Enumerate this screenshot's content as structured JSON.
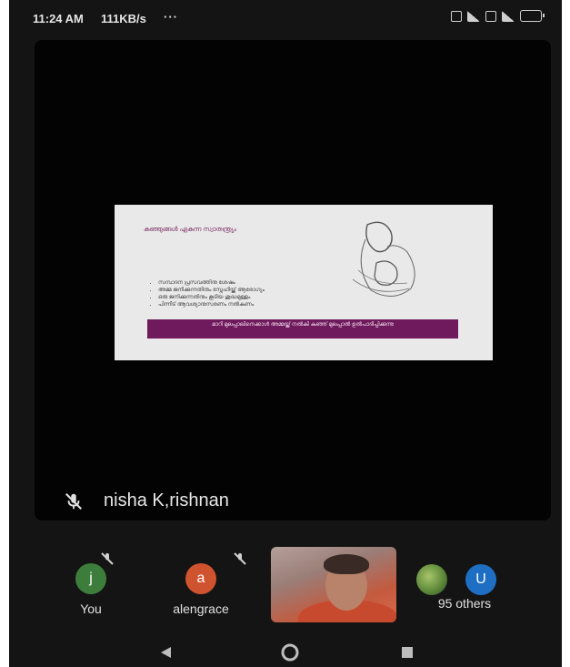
{
  "status_bar": {
    "time": "11:24 AM",
    "speed": "111KB/s",
    "more": "···",
    "icons": [
      "sim-icon",
      "signal-icon",
      "sim2-icon",
      "signal2-icon",
      "battery-icon"
    ]
  },
  "presentation": {
    "heading": "കുഞ്ഞുങ്ങൾ ഏകുന്ന സ്വാതന്ത്ര്യം",
    "bullets": [
      "സമ്പാദന പ്രസവത്തിനു ശേഷം",
      "അമ്മ ജനിക്കുന്നതിനും സ്നേഹിയ്ക്ക് ആരോഗ്യം",
      "ഒരു ജനിക്കുന്നതിനും കൂടിയ ശുദ്ധമുള്ളം",
      "പിന്നീട് ആവശ്യാനുസരണം നൽകണം"
    ],
    "banner": "മാറി മുലപ്പാലിനെക്കാൾ അമ്മയ്ക്ക് നൽകി കുഞ്ഞ് മുലപ്പാൽ ഉൽപാദിപ്പിക്കുന്നു"
  },
  "speaker": {
    "name": "nisha K,rishnan",
    "mic_icon": "mic-off-icon"
  },
  "participants": [
    {
      "initial": "j",
      "label": "You",
      "color": "#3d7d3c"
    },
    {
      "initial": "a",
      "label": "alengrace",
      "color": "#d0532f"
    }
  ],
  "others": {
    "initial": "U",
    "label": "95 others",
    "color": "#1e6fc4"
  },
  "nav": {
    "icons": [
      "back-icon",
      "home-icon",
      "recents-icon"
    ]
  }
}
